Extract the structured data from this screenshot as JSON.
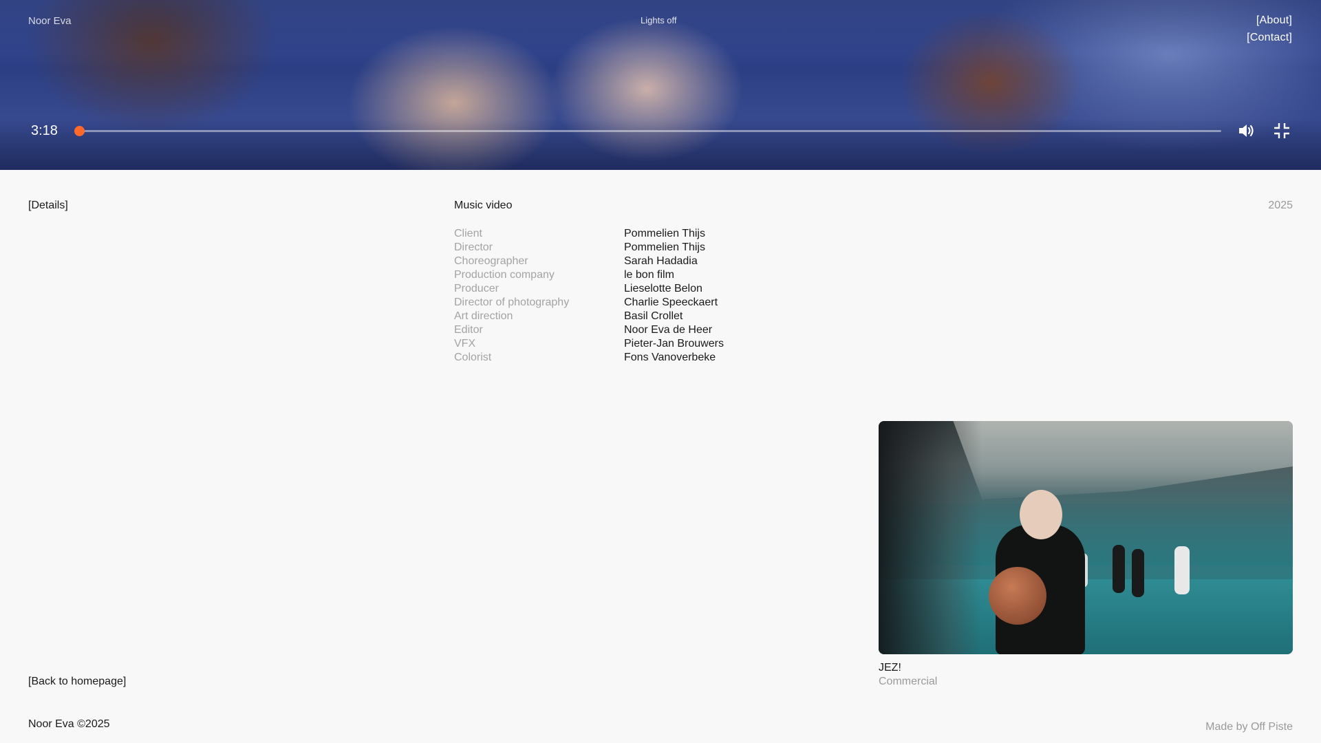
{
  "header": {
    "brand": "Noor Eva",
    "lights_toggle": "Lights off",
    "nav": [
      {
        "label": "[About]"
      },
      {
        "label": "[Contact]"
      }
    ]
  },
  "player": {
    "time": "3:18",
    "progress_fraction": 0.0,
    "icons": {
      "volume": "volume-icon",
      "exit_fullscreen": "exit-fullscreen-icon"
    }
  },
  "colors": {
    "accent": "#ff6a2a",
    "text": "#1a1a1a",
    "muted": "#a3a3a3",
    "background": "#f8f8f8"
  },
  "details": {
    "label": "[Details]",
    "category": "Music video",
    "year": "2025",
    "credits": [
      {
        "role": "Client",
        "name": "Pommelien Thijs"
      },
      {
        "role": "Director",
        "name": "Pommelien Thijs"
      },
      {
        "role": "Choreographer",
        "name": "Sarah Hadadia"
      },
      {
        "role": "Production company",
        "name": "le bon film"
      },
      {
        "role": "Producer",
        "name": "Lieselotte Belon"
      },
      {
        "role": "Director of photography",
        "name": "Charlie Speeckaert"
      },
      {
        "role": "Art direction",
        "name": "Basil Crollet"
      },
      {
        "role": "Editor",
        "name": "Noor Eva de Heer"
      },
      {
        "role": "VFX",
        "name": "Pieter-Jan Brouwers"
      },
      {
        "role": "Colorist",
        "name": "Fons Vanoverbeke"
      }
    ]
  },
  "next_project": {
    "title": "JEZ!",
    "type": "Commercial"
  },
  "footer": {
    "back_link": "[Back to homepage]",
    "copyright": "Noor Eva ©2025",
    "made_by": "Made by Off Piste"
  }
}
